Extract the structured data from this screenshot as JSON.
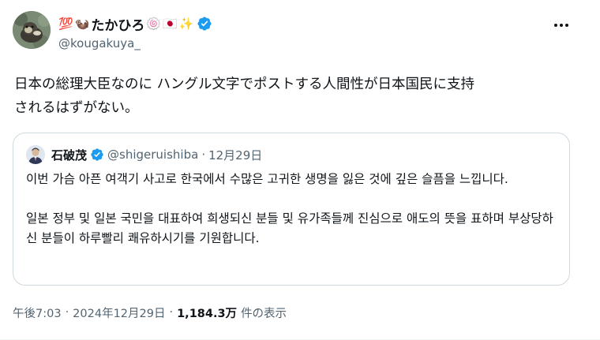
{
  "author": {
    "name_prefix_emoji": "💯",
    "name_otter_emoji": "🦦",
    "display_name": "たかひろ",
    "name_suffix_emojis": [
      "🍥",
      "🇯🇵",
      "✨"
    ],
    "handle": "@kougakuya_",
    "verified": true
  },
  "tweet": {
    "text_line1": "日本の総理大臣なのに ハングル文字でポストする人間性が日本国民に支持",
    "text_line2": "されるはずがない。"
  },
  "quoted_tweet": {
    "name": "石破茂",
    "verified": true,
    "handle": "@shigeruishiba",
    "separator": "·",
    "date": "12月29日",
    "paragraph1": "이번 가슴 아픈 여객기 사고로 한국에서 수많은 고귀한 생명을 잃은 것에 깊은 슬픔을 느낍니다.",
    "paragraph2": "일본 정부 및 일본 국민을 대표하여 희생되신 분들 및 유가족들께 진심으로 애도의 뜻을 표하며 부상당하신 분들이 하루빨리 쾌유하시기를 기원합니다."
  },
  "meta": {
    "time": "午後7:03",
    "sep1": "·",
    "date": "2024年12月29日",
    "sep2": "·",
    "views_count": "1,184.3万",
    "views_label": "件の表示"
  },
  "colors": {
    "verified_blue": "#1d9bf0",
    "secondary_text": "#536471",
    "border": "#cfd9de"
  },
  "icons": {
    "more": "more-horizontal-icon",
    "verified": "verified-badge-icon"
  }
}
